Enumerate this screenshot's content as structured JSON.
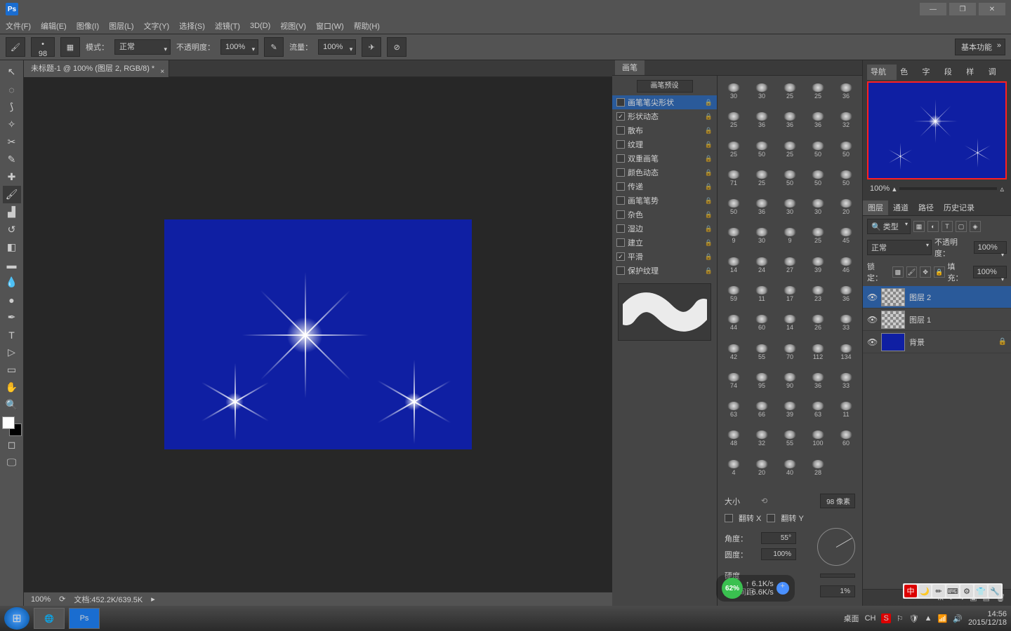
{
  "title": "Ps",
  "menus": [
    "文件(F)",
    "编辑(E)",
    "图像(I)",
    "图层(L)",
    "文字(Y)",
    "选择(S)",
    "滤镜(T)",
    "3D(D)",
    "视图(V)",
    "窗口(W)",
    "帮助(H)"
  ],
  "options": {
    "size_num": "98",
    "mode_label": "模式：",
    "mode_value": "正常",
    "opacity_label": "不透明度：",
    "opacity_value": "100%",
    "flow_label": "流量：",
    "flow_value": "100%",
    "workspace": "基本功能"
  },
  "doc_tab": "未标题-1 @ 100% (图层 2, RGB/8) *",
  "status": {
    "zoom": "100%",
    "docinfo": "文档:452.2K/639.5K"
  },
  "brush_panel": {
    "tab": "画笔",
    "preset_btn": "画笔预设",
    "rows": [
      {
        "label": "画笔笔尖形状",
        "check": "",
        "active": true
      },
      {
        "label": "形状动态",
        "check": "✓"
      },
      {
        "label": "散布",
        "check": ""
      },
      {
        "label": "纹理",
        "check": ""
      },
      {
        "label": "双重画笔",
        "check": ""
      },
      {
        "label": "颜色动态",
        "check": ""
      },
      {
        "label": "传递",
        "check": ""
      },
      {
        "label": "画笔笔势",
        "check": ""
      },
      {
        "label": "杂色",
        "check": ""
      },
      {
        "label": "湿边",
        "check": ""
      },
      {
        "label": "建立",
        "check": ""
      },
      {
        "label": "平滑",
        "check": "✓"
      },
      {
        "label": "保护纹理",
        "check": ""
      }
    ],
    "thumbs": [
      "30",
      "30",
      "25",
      "25",
      "36",
      "25",
      "36",
      "36",
      "36",
      "32",
      "25",
      "50",
      "25",
      "50",
      "50",
      "71",
      "25",
      "50",
      "50",
      "50",
      "50",
      "36",
      "30",
      "30",
      "20",
      "9",
      "30",
      "9",
      "25",
      "45",
      "14",
      "24",
      "27",
      "39",
      "46",
      "59",
      "11",
      "17",
      "23",
      "36",
      "44",
      "60",
      "14",
      "26",
      "33",
      "42",
      "55",
      "70",
      "112",
      "134",
      "74",
      "95",
      "90",
      "36",
      "33",
      "63",
      "66",
      "39",
      "63",
      "11",
      "48",
      "32",
      "55",
      "100",
      "60",
      "4",
      "20",
      "40",
      "28"
    ],
    "size_label": "大小",
    "size_value": "98 像素",
    "flipx": "翻转 X",
    "flipy": "翻转 Y",
    "angle_label": "角度：",
    "angle_value": "55°",
    "round_label": "圆度：",
    "round_value": "100%",
    "hardness_label": "硬度",
    "spacing_label": "间距",
    "spacing_value": "1%"
  },
  "navigator": {
    "tabs": [
      "导航器",
      "色板",
      "字符",
      "段落",
      "样式",
      "调整"
    ],
    "zoom": "100%"
  },
  "layers_panel": {
    "tabs": [
      "图层",
      "通道",
      "路径",
      "历史记录"
    ],
    "kind": "类型",
    "blend": "正常",
    "opacity_label": "不透明度：",
    "opacity_value": "100%",
    "lock_label": "锁定：",
    "fill_label": "填充：",
    "fill_value": "100%",
    "layers": [
      {
        "name": "图层 2",
        "sel": true,
        "bg": false
      },
      {
        "name": "图层 1",
        "sel": false,
        "bg": false
      },
      {
        "name": "背景",
        "sel": false,
        "bg": true
      }
    ]
  },
  "taskbar": {
    "desktop": "桌面",
    "net_pct": "62%",
    "net_down": "6.1K/s",
    "net_up": "6.6K/s",
    "ime": "CH",
    "time": "14:56",
    "date": "2015/12/18"
  },
  "ime_badge": [
    "中",
    "🌙",
    "✏",
    "⌨",
    "⚙",
    "👕",
    "🔧"
  ]
}
